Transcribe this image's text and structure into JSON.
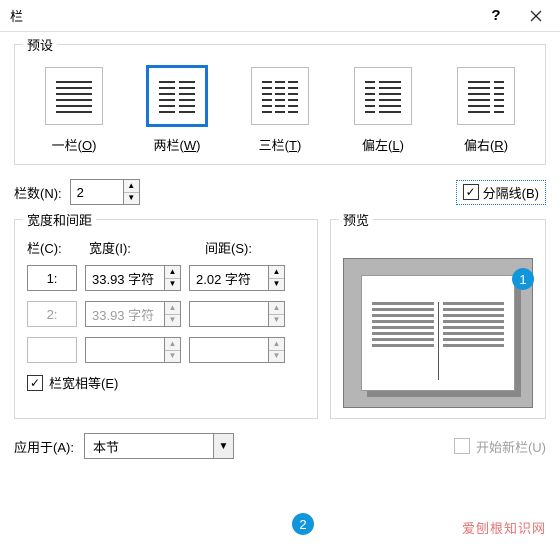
{
  "window": {
    "title": "栏"
  },
  "presets_legend": "预设",
  "presets": [
    {
      "label": "一栏(",
      "key": "O",
      "tail": ")"
    },
    {
      "label": "两栏(",
      "key": "W",
      "tail": ")"
    },
    {
      "label": "三栏(",
      "key": "T",
      "tail": ")"
    },
    {
      "label": "偏左(",
      "key": "L",
      "tail": ")"
    },
    {
      "label": "偏右(",
      "key": "R",
      "tail": ")"
    }
  ],
  "columns_count_label": "栏数(N):",
  "columns_count_value": "2",
  "separator_label": "分隔线(B)",
  "separator_checked": true,
  "width_legend": "宽度和间距",
  "col_header": "栏(C):",
  "width_header": "宽度(I):",
  "spacing_header": "间距(S):",
  "rows": [
    {
      "idx": "1:",
      "width": "33.93 字符",
      "spacing": "2.02 字符",
      "enabled": true
    },
    {
      "idx": "2:",
      "width": "33.93 字符",
      "spacing": "",
      "enabled": false
    },
    {
      "idx": "",
      "width": "",
      "spacing": "",
      "enabled": false
    }
  ],
  "equal_label": "栏宽相等(E)",
  "equal_checked": true,
  "preview_legend": "预览",
  "apply_label": "应用于(A):",
  "apply_value": "本节",
  "newcol_label": "开始新栏(U)",
  "badges": {
    "b1": "1",
    "b2": "2"
  },
  "watermark": "爱刨根知识网"
}
